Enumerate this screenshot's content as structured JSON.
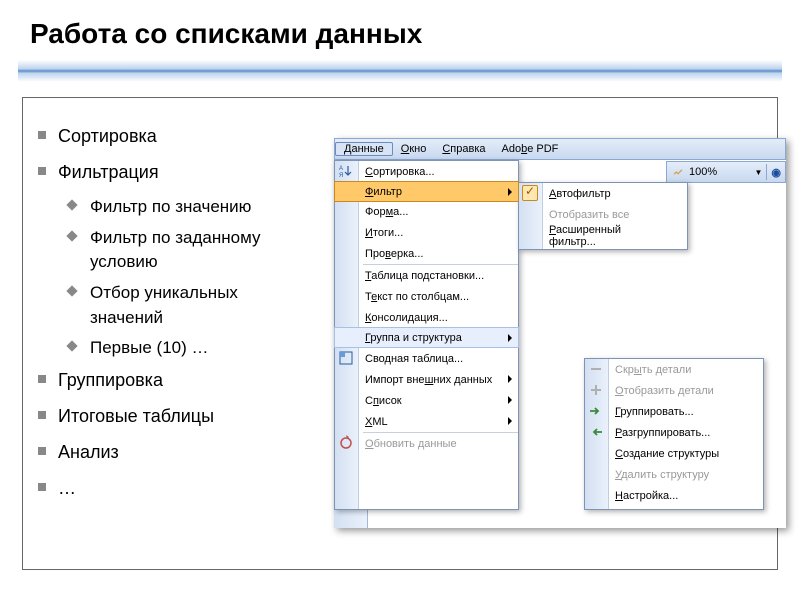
{
  "title": "Работа со списками данных",
  "bullets": {
    "i1": "Сортировка",
    "i2": "Фильтрация",
    "i2a": "Фильтр по значению",
    "i2b": "Фильтр по заданному условию",
    "i2c": "Отбор уникальных значений",
    "i2d": "Первые (10) …",
    "i3": "Группировка",
    "i4": "Итоговые таблицы",
    "i5": "Анализ",
    "i6": "…"
  },
  "menubar": {
    "data": "Данные",
    "window": "Окно",
    "help": "Справка",
    "adobe": "Adobe PDF"
  },
  "toolbar": {
    "zoom": "100%"
  },
  "menu1": {
    "sort": "Сортировка...",
    "filter": "Фильтр",
    "form": "Форма...",
    "totals": "Итоги...",
    "validation": "Проверка...",
    "lookup": "Таблица подстановки...",
    "textcols": "Текст по столбцам...",
    "consolidate": "Консолидация...",
    "group": "Группа и структура",
    "pivot": "Сводная таблица...",
    "import": "Импорт внешних данных",
    "list": "Список",
    "xml": "XML",
    "refresh": "Обновить данные"
  },
  "menu2": {
    "autofilter": "Автофильтр",
    "showall": "Отобразить все",
    "advanced": "Расширенный фильтр..."
  },
  "menu3": {
    "hide": "Скрыть детали",
    "show": "Отобразить детали",
    "group": "Группировать...",
    "ungroup": "Разгруппировать...",
    "create": "Создание структуры",
    "delete": "Удалить структуру",
    "settings": "Настройка..."
  }
}
